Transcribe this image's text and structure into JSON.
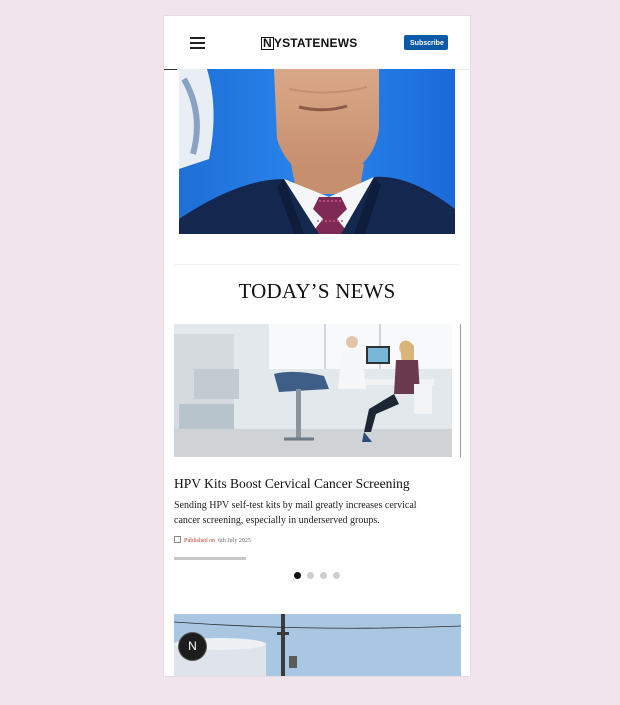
{
  "header": {
    "logo_mark": "N",
    "logo_text": "YSTATENEWS",
    "subscribe_label": "Subscribe"
  },
  "section": {
    "title": "TODAY’S NEWS"
  },
  "article": {
    "title": "HPV Kits Boost Cervical Cancer Screening",
    "description": "Sending HPV self-test kits by mail greatly increases cervical cancer screening, especially in underserved groups.",
    "published_label": "Published on",
    "published_date": "6th July 2025"
  },
  "carousel": {
    "active_index": 0,
    "total": 4,
    "progress": 0.25
  },
  "fab": {
    "label": "N"
  },
  "colors": {
    "page_bg": "#f1e4ec",
    "subscribe_bg": "#0b5aa8",
    "published_accent": "#c0392b"
  },
  "icons": [
    "menu-icon",
    "calendar-icon"
  ]
}
